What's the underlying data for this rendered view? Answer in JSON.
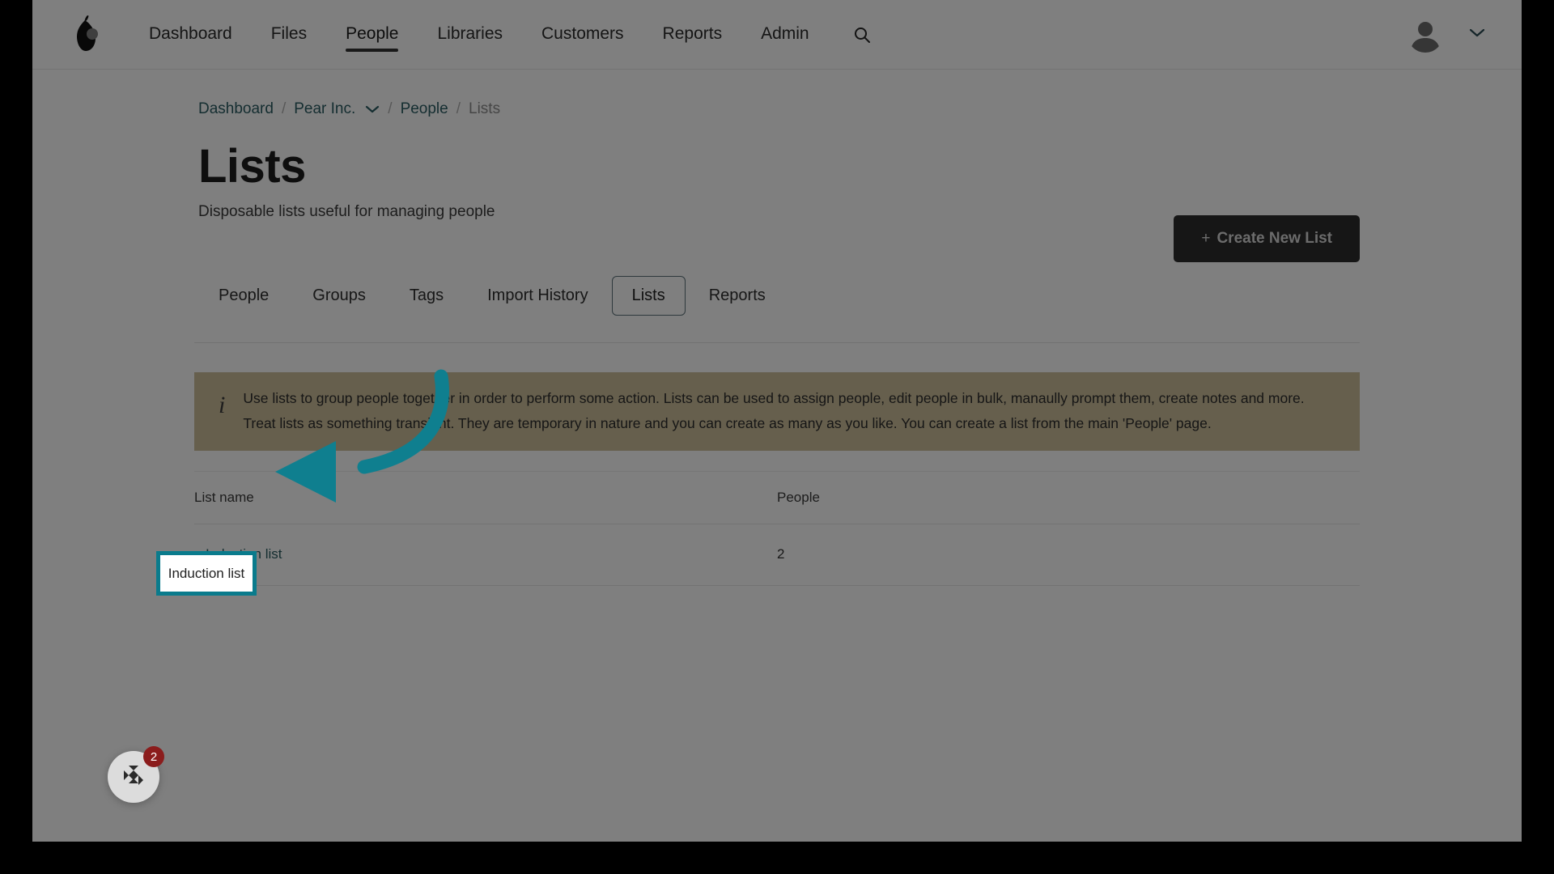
{
  "nav": {
    "logo_icon": "pear-logo",
    "items": [
      {
        "label": "Dashboard",
        "active": false
      },
      {
        "label": "Files",
        "active": false
      },
      {
        "label": "People",
        "active": true
      },
      {
        "label": "Libraries",
        "active": false
      },
      {
        "label": "Customers",
        "active": false
      },
      {
        "label": "Reports",
        "active": false
      },
      {
        "label": "Admin",
        "active": false
      }
    ],
    "search_icon": "search-icon",
    "avatar_icon": "user-avatar-icon",
    "account_caret_icon": "chevron-down-icon"
  },
  "breadcrumb": {
    "dashboard": "Dashboard",
    "org": "Pear Inc.",
    "people": "People",
    "current": "Lists",
    "separator": "/",
    "caret_icon": "chevron-down-icon"
  },
  "header": {
    "title": "Lists",
    "subtitle": "Disposable lists useful for managing people",
    "create_button_plus": "+",
    "create_button_label": "Create New List"
  },
  "tabs": [
    {
      "label": "People",
      "selected": false
    },
    {
      "label": "Groups",
      "selected": false
    },
    {
      "label": "Tags",
      "selected": false
    },
    {
      "label": "Import History",
      "selected": false
    },
    {
      "label": "Lists",
      "selected": true
    },
    {
      "label": "Reports",
      "selected": false
    }
  ],
  "banner": {
    "icon": "info-icon",
    "line1": "Use lists to group people together in order to perform some action. Lists can be used to assign people, edit people in bulk, manaully prompt them, create notes and more.",
    "line2": "Treat lists as something transient. They are temporary in nature and you can create as many as you like. You can create a list from the main 'People' page.",
    "background": "#cdbf9a"
  },
  "table": {
    "columns": [
      "List name",
      "People"
    ],
    "rows": [
      {
        "name": "Induction list",
        "people": "2"
      }
    ]
  },
  "annotation": {
    "highlight_target": "Induction list",
    "highlight_color": "#0a7b8c",
    "arrow_icon": "curved-arrow-icon"
  },
  "chat": {
    "icon": "chat-widget-icon",
    "badge_count": "2",
    "badge_color": "#8b1c1c"
  }
}
